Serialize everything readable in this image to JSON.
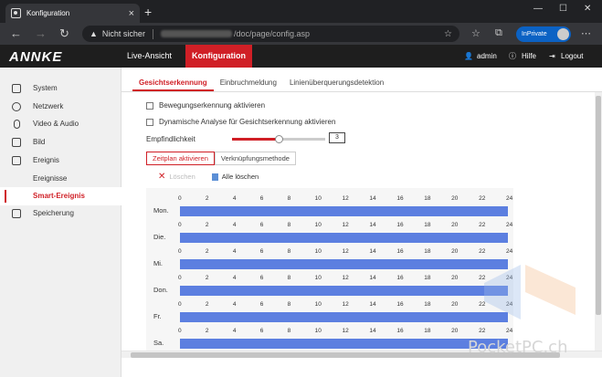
{
  "browser": {
    "tab_title": "Konfiguration",
    "security_label": "Nicht sicher",
    "url_path": "/doc/page/config.asp",
    "inprivate_label": "InPrivate"
  },
  "header": {
    "logo": "ANNKE",
    "nav": [
      "Live-Ansicht",
      "Konfiguration"
    ],
    "user": "admin",
    "help": "Hilfe",
    "logout": "Logout"
  },
  "sidebar": {
    "items": [
      {
        "label": "System",
        "icon": "monitor-icon"
      },
      {
        "label": "Netzwerk",
        "icon": "globe-icon"
      },
      {
        "label": "Video & Audio",
        "icon": "microphone-icon"
      },
      {
        "label": "Bild",
        "icon": "image-icon"
      },
      {
        "label": "Ereignis",
        "icon": "calendar-icon"
      },
      {
        "label": "Ereignisse",
        "sub": true
      },
      {
        "label": "Smart-Ereignis",
        "sub": true,
        "active": true
      },
      {
        "label": "Speicherung",
        "icon": "storage-icon"
      }
    ]
  },
  "main": {
    "tabs": [
      "Gesichtserkennung",
      "Einbruchmeldung",
      "Linienüberquerungsdetektion"
    ],
    "checkbox1": "Bewegungserkennung aktivieren",
    "checkbox2": "Dynamische Analyse für Gesichtserkennung aktivieren",
    "sensitivity_label": "Empfindlichkeit",
    "sensitivity_value": "3",
    "sensitivity_fraction": 0.5,
    "subtabs": [
      "Zeitplan aktivieren",
      "Verknüpfungsmethode"
    ],
    "delete_label": "Löschen",
    "delete_all_label": "Alle löschen",
    "hours": [
      "0",
      "2",
      "4",
      "6",
      "8",
      "10",
      "12",
      "14",
      "16",
      "18",
      "20",
      "22",
      "24"
    ],
    "days": [
      "Mon.",
      "Die.",
      "Mi.",
      "Don.",
      "Fr.",
      "Sa."
    ]
  },
  "watermark": "PocketPC.ch",
  "colors": {
    "accent": "#d01f26",
    "schedule_bar": "#5c7fe0"
  }
}
